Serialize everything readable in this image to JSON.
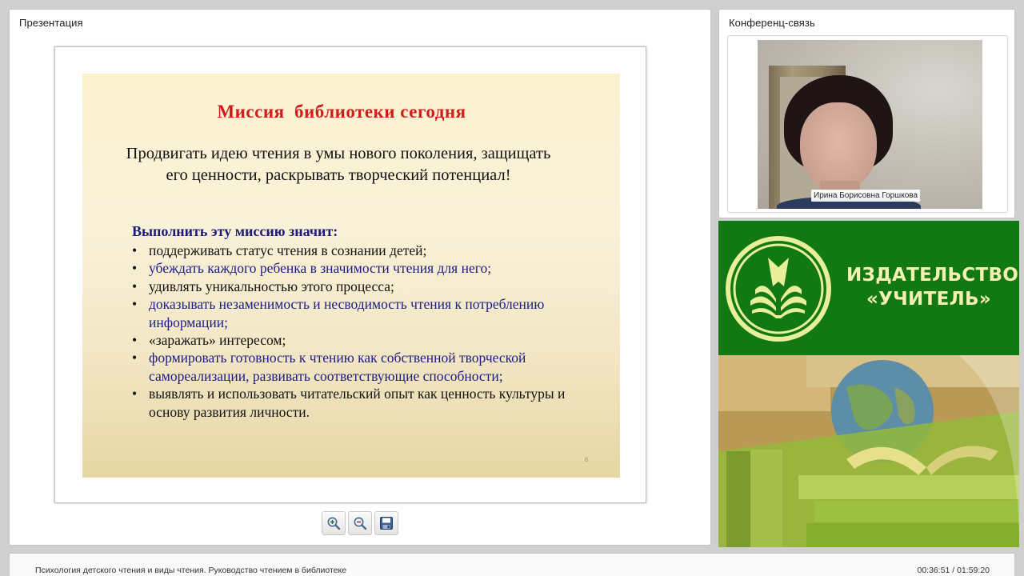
{
  "presentation": {
    "panel_title": "Презентация",
    "slide": {
      "title": "Миссия  библиотеки сегодня",
      "lead": "Продвигать идею чтения в умы нового поколения, защищать его ценности, раскрывать творческий потенциал!",
      "subhead": "Выполнить эту миссию значит:",
      "bullets": [
        {
          "text": "поддерживать статус чтения в сознании детей;",
          "color": "#111111"
        },
        {
          "text": "убеждать каждого ребенка в значимости чтения для него;",
          "color": "#1c1c86"
        },
        {
          "text": "удивлять уникальностью этого процесса;",
          "color": "#111111"
        },
        {
          "text": "доказывать незаменимость и несводимость чтения к потреблению информации;",
          "color": "#1c1c86"
        },
        {
          "text": "«заражать» интересом;",
          "color": "#111111"
        },
        {
          "text": "формировать готовность к чтению как собственной творческой самореализации, развивать соответствующие способности;",
          "color": "#1c1c86"
        },
        {
          "text": "выявлять и использовать читательский опыт как ценность культуры и основу развития личности.",
          "color": "#111111"
        }
      ],
      "bullet_glyph": "•",
      "page_number": "8"
    },
    "toolbar": {
      "zoom_in_icon": "zoom-in-icon",
      "zoom_out_icon": "zoom-out-icon",
      "save_icon": "save-icon"
    }
  },
  "conference": {
    "panel_title": "Конференц-связь",
    "participant_name": "Ирина Борисовна Горшкова"
  },
  "banner": {
    "publisher_line1": "ИЗДАТЕЛЬСТВО",
    "publisher_line2": "«УЧИТЕЛЬ»",
    "brand_green": "#127813",
    "brand_cream": "#f3f0b0"
  },
  "footer": {
    "lecture_title": "Психология детского чтения и виды чтения. Руководство чтением в библиотеке",
    "time_current": "00:36:51",
    "time_total": "01:59:20",
    "time_display": "00:36:51 / 01:59:20"
  }
}
